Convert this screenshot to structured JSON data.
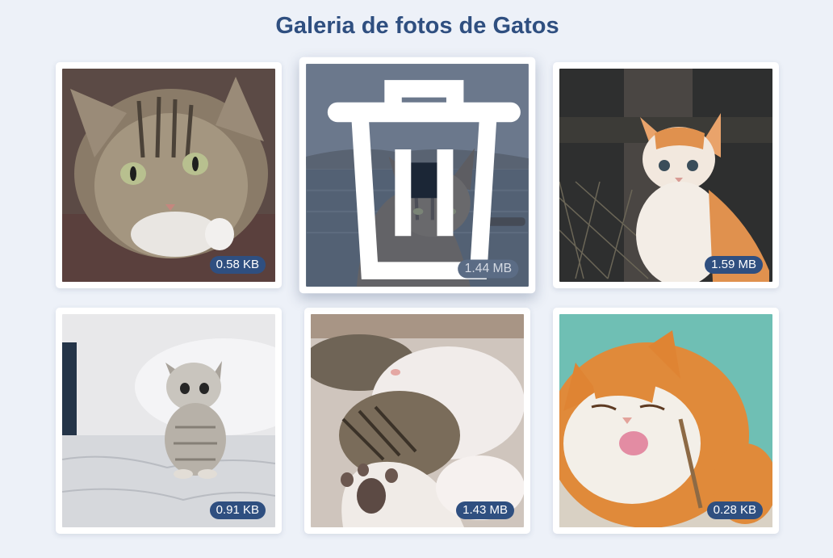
{
  "header": {
    "title": "Galeria de fotos de Gatos"
  },
  "gallery": {
    "photos": [
      {
        "size": "0.58 KB",
        "state": "normal"
      },
      {
        "size": "1.44 MB",
        "state": "hover",
        "action": "delete"
      },
      {
        "size": "1.59 MB",
        "state": "normal"
      },
      {
        "size": "0.91 KB",
        "state": "normal"
      },
      {
        "size": "1.43 MB",
        "state": "normal"
      },
      {
        "size": "0.28 KB",
        "state": "normal"
      }
    ]
  },
  "icons": {
    "delete": "trash-icon"
  },
  "colors": {
    "background": "#edf1f8",
    "title": "#2f4f80",
    "badge": "#2f4f80",
    "delete_button": "#1b2636"
  }
}
